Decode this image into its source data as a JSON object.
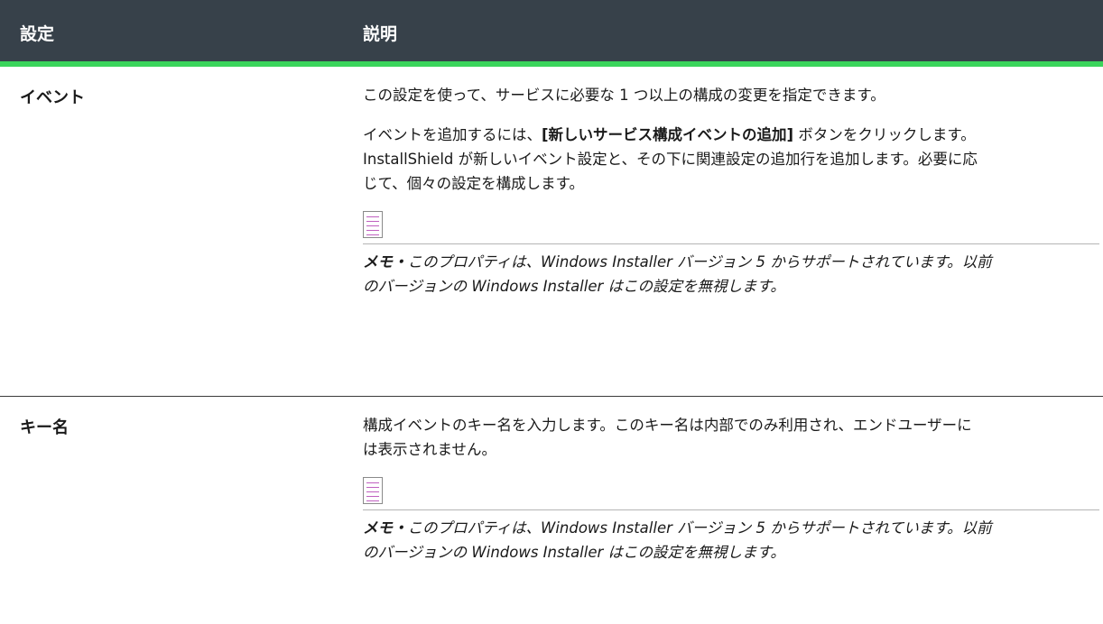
{
  "header": {
    "setting": "設定",
    "description": "説明"
  },
  "rows": [
    {
      "name": "イベント",
      "p1": "この設定を使って、サービスに必要な 1 つ以上の構成の変更を指定できます。",
      "p2_before": "イベントを追加するには、",
      "p2_bold": "[新しいサービス構成イベントの追加]",
      "p2_after": " ボタンをクリックします。InstallShield が新しいイベント設定と、その下に関連設定の追加行を追加します。必要に応じて、個々の設定を構成します。",
      "note_label": "メモ・",
      "note_text": "このプロパティは、Windows Installer バージョン 5 からサポートされています。以前のバージョンの Windows Installer はこの設定を無視します。",
      "note_icon": "note-icon"
    },
    {
      "name": "キー名",
      "p1": "構成イベントのキー名を入力します。このキー名は内部でのみ利用され、エンドユーザーには表示されません。",
      "note_label": "メモ・",
      "note_text": "このプロパティは、Windows Installer バージョン 5 からサポートされています。以前のバージョンの Windows Installer はこの設定を無視します。",
      "note_icon": "note-icon"
    }
  ],
  "colors": {
    "header_bg": "#37414a",
    "accent": "#3ad45b"
  }
}
